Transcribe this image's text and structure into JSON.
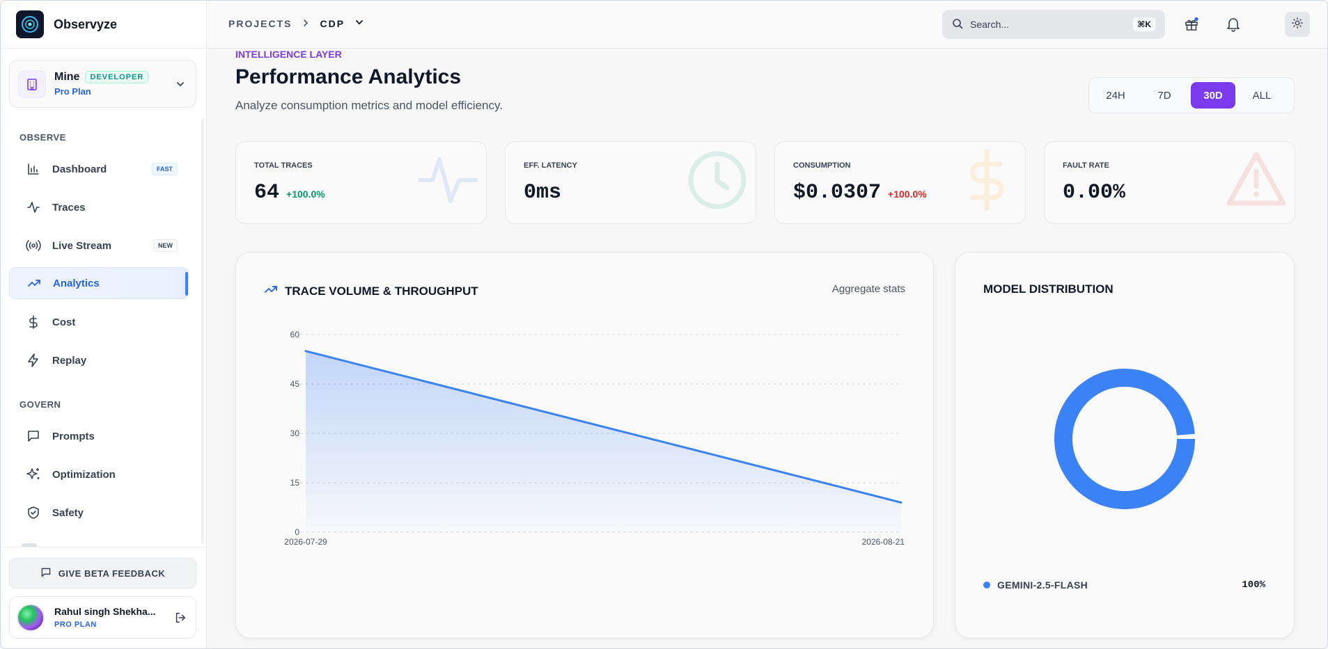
{
  "app": {
    "name": "Observyze"
  },
  "workspace": {
    "name": "Mine",
    "badge": "DEVELOPER",
    "plan": "Pro Plan"
  },
  "sidebar": {
    "sections": [
      {
        "label": "OBSERVE"
      },
      {
        "label": "GOVERN"
      }
    ],
    "items": [
      {
        "label": "Dashboard",
        "icon": "bar-chart-icon",
        "badge": "FAST"
      },
      {
        "label": "Traces",
        "icon": "activity-icon"
      },
      {
        "label": "Live Stream",
        "icon": "broadcast-icon",
        "badge": "NEW"
      },
      {
        "label": "Analytics",
        "icon": "trending-up-icon",
        "active": true
      },
      {
        "label": "Cost",
        "icon": "dollar-icon"
      },
      {
        "label": "Replay",
        "icon": "zap-icon"
      },
      {
        "label": "Prompts",
        "icon": "message-square-icon"
      },
      {
        "label": "Optimization",
        "icon": "sparkles-icon"
      },
      {
        "label": "Safety",
        "icon": "shield-check-icon"
      }
    ],
    "feedback_label": "GIVE BETA FEEDBACK",
    "user": {
      "name": "Rahul singh Shekha...",
      "plan": "PRO PLAN"
    }
  },
  "topbar": {
    "breadcrumb": [
      "PROJECTS",
      "CDP"
    ],
    "search": {
      "placeholder": "Search...",
      "shortcut": "⌘K"
    }
  },
  "page": {
    "eyebrow": "INTELLIGENCE LAYER",
    "title": "Performance Analytics",
    "subtitle": "Analyze consumption metrics and model efficiency.",
    "ranges": [
      "24H",
      "7D",
      "30D",
      "ALL"
    ],
    "active_range": "30D"
  },
  "kpis": [
    {
      "label": "TOTAL TRACES",
      "value": "64",
      "delta": "+100.0%",
      "delta_color": "#059669"
    },
    {
      "label": "EFF. LATENCY",
      "value": "0ms",
      "delta": ""
    },
    {
      "label": "CONSUMPTION",
      "value": "$0.0307",
      "delta": "+100.0%",
      "delta_color": "#dc2626"
    },
    {
      "label": "FAULT RATE",
      "value": "0.00%",
      "delta": ""
    }
  ],
  "trace_card": {
    "title": "TRACE VOLUME & THROUGHPUT",
    "link": "Aggregate stats"
  },
  "model_card": {
    "title": "MODEL DISTRIBUTION"
  },
  "colors": {
    "accent": "#7c3aed",
    "primary": "#3b82f6"
  },
  "chart_data": [
    {
      "type": "area",
      "x": [
        "2026-07-29",
        "2026-08-21"
      ],
      "series": [
        {
          "values": [
            55,
            9
          ]
        }
      ],
      "xticks": [
        "2026-07-29",
        "2026-08-21"
      ],
      "yticks": [
        0,
        15,
        30,
        45,
        60
      ],
      "ylim": [
        0,
        60
      ],
      "grid": true
    },
    {
      "type": "pie",
      "style": "donut",
      "categories": [
        "GEMINI-2.5-FLASH"
      ],
      "values": [
        100
      ],
      "labels": [
        "100%"
      ],
      "legend": "bottom"
    }
  ]
}
